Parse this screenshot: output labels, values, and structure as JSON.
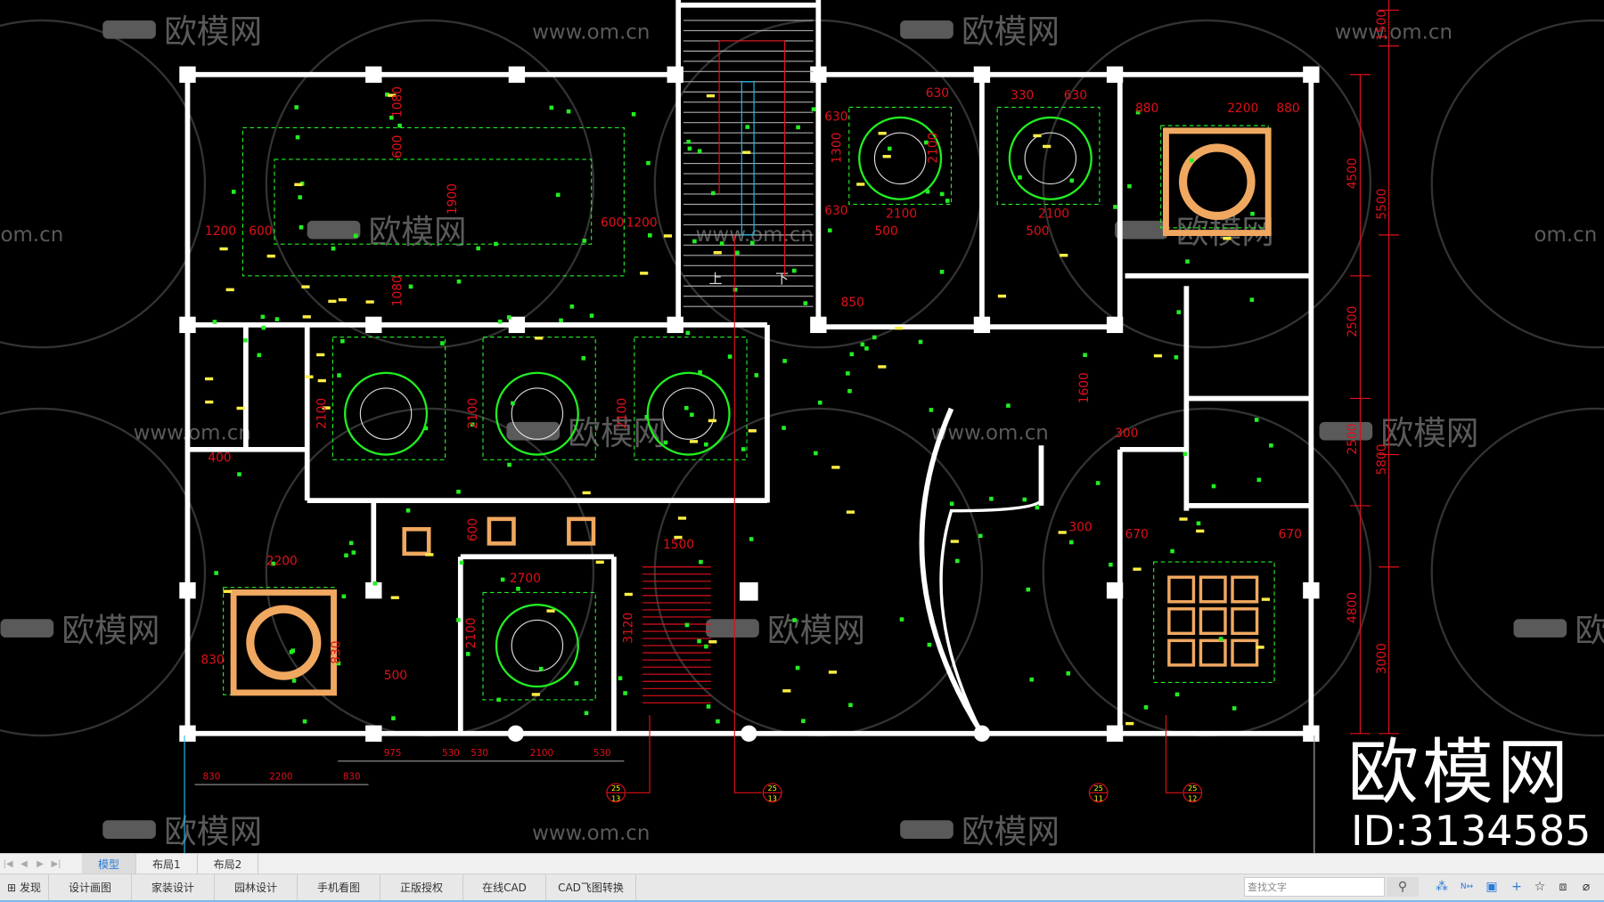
{
  "watermark": {
    "brand": "欧模网",
    "url": "www.om.cn",
    "url_partial": "om.cn",
    "id_label": "ID:3134585"
  },
  "drawing": {
    "room_labels": [
      "上",
      "下"
    ],
    "dimensions_top": [
      "1200",
      "600",
      "600",
      "1200",
      "1080",
      "600",
      "1900",
      "1080",
      "630",
      "630",
      "1300",
      "2100",
      "2100",
      "630",
      "330",
      "630",
      "2100",
      "880",
      "2200",
      "880",
      "500",
      "500",
      "850"
    ],
    "dimensions_mid": [
      "2100",
      "2100",
      "2100",
      "400",
      "1600",
      "300",
      "670",
      "670",
      "2200",
      "830",
      "830",
      "1500",
      "3120",
      "300",
      "2700",
      "500",
      "2100",
      "600"
    ],
    "dimensions_bottom": [
      "975",
      "530",
      "530",
      "2100",
      "530",
      "830",
      "2200",
      "830"
    ],
    "dimensions_right_inner": [
      "4500",
      "2500",
      "2500",
      "4800"
    ],
    "dimensions_right_outer": [
      "1500",
      "5500",
      "5800",
      "3000"
    ],
    "section_marks": [
      {
        "top": "25",
        "bottom": "13"
      },
      {
        "top": "25",
        "bottom": "13"
      },
      {
        "top": "25",
        "bottom": "11"
      },
      {
        "top": "25",
        "bottom": "12"
      }
    ],
    "colors": {
      "wall": "#ffffff",
      "dimension": "#e0101a",
      "light": "#22ee22",
      "tile": "#f0a860",
      "cyan": "#20c0f0",
      "watermark": "#5a5a5a"
    }
  },
  "layout_tabs": {
    "items": [
      "模型",
      "布局1",
      "布局2"
    ],
    "active": "模型"
  },
  "toolbar": {
    "items": [
      "发现",
      "设计画图",
      "家装设计",
      "园林设计",
      "手机看图",
      "正版授权",
      "在线CAD",
      "CAD飞图转换"
    ],
    "search_placeholder": "查找文字"
  }
}
